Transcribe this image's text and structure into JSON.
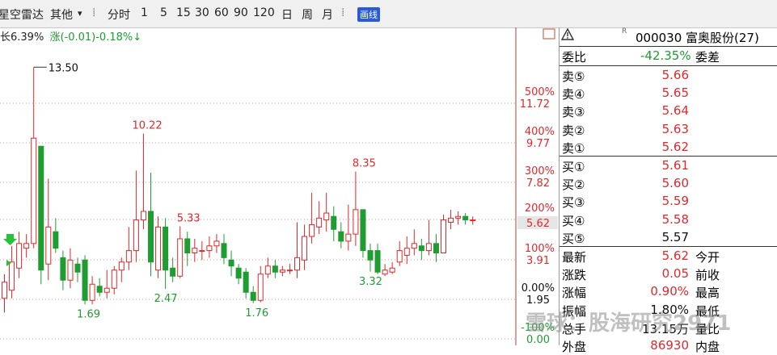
{
  "toolbar": {
    "name": "星空雷达",
    "other": "其他",
    "dropdown": "▾",
    "periods": [
      "分时",
      "1",
      "5",
      "15",
      "30",
      "60",
      "90",
      "120",
      "日",
      "周",
      "月"
    ],
    "draw_badge": "画线"
  },
  "info": {
    "left_fragment": "长6.39%",
    "change": "涨(-0.01)-0.18%↓"
  },
  "right_axis": [
    {
      "pct": "500%",
      "price": "11.72"
    },
    {
      "pct": "400%",
      "price": "9.77"
    },
    {
      "pct": "300%",
      "price": "7.82"
    },
    {
      "pct": "200%",
      "price": "5.62"
    },
    {
      "pct": "100%",
      "price": "3.91"
    },
    {
      "pct": "0.00%",
      "price": "1.95"
    },
    {
      "pct": "-100%",
      "price": "0.00"
    }
  ],
  "annotations": [
    "13.50",
    "10.22",
    "5.33",
    "8.35",
    "2.47",
    "1.69",
    "1.76",
    "3.32"
  ],
  "panel": {
    "code_line": "000030 富奥股份(27)",
    "r_mark": "R",
    "weibi_label": "委比",
    "weibi_value": "-42.35%",
    "weicha_label": "委差",
    "asks": [
      {
        "label": "卖⑤",
        "price": "5.66"
      },
      {
        "label": "卖④",
        "price": "5.65"
      },
      {
        "label": "卖③",
        "price": "5.64"
      },
      {
        "label": "卖②",
        "price": "5.63"
      },
      {
        "label": "卖①",
        "price": "5.62"
      }
    ],
    "bids": [
      {
        "label": "买①",
        "price": "5.61"
      },
      {
        "label": "买②",
        "price": "5.60"
      },
      {
        "label": "买③",
        "price": "5.59"
      },
      {
        "label": "买④",
        "price": "5.58"
      },
      {
        "label": "买⑤",
        "price": "5.57"
      }
    ],
    "stats": [
      {
        "label": "最新",
        "value": "5.62",
        "label2": "今开"
      },
      {
        "label": "涨跌",
        "value": "0.05",
        "label2": "前收"
      },
      {
        "label": "涨幅",
        "value": "0.90%",
        "label2": "最高"
      },
      {
        "label": "振幅",
        "value": "1.80%",
        "label2": "最低"
      },
      {
        "label": "总手",
        "value": "13.15万",
        "label2": "量比"
      },
      {
        "label": "外盘",
        "value": "86930",
        "label2": "内盘"
      }
    ]
  },
  "watermark": "雪球：股海研究2971",
  "colors": {
    "up": "#e0282c",
    "down": "#1f9c32",
    "grid": "#ce9a9a"
  },
  "chart_data": {
    "type": "candlestick",
    "price_levels": [
      11.72,
      9.77,
      7.82,
      5.62,
      3.91,
      1.95,
      0.0
    ],
    "bars": [
      {
        "o": 2.0,
        "c": 2.8,
        "h": 3.2,
        "l": 1.3
      },
      {
        "o": 2.4,
        "c": 3.8,
        "h": 4.5,
        "l": 2.0
      },
      {
        "o": 3.5,
        "c": 4.6,
        "h": 5.1,
        "l": 3.0
      },
      {
        "o": 4.4,
        "c": 4.6,
        "h": 5.0,
        "l": 4.0
      },
      {
        "o": 4.6,
        "c": 10.0,
        "h": 13.5,
        "l": 4.4
      },
      {
        "o": 9.6,
        "c": 3.4,
        "h": 9.6,
        "l": 2.7
      },
      {
        "o": 3.7,
        "c": 5.3,
        "h": 8.0,
        "l": 2.9
      },
      {
        "o": 5.1,
        "c": 4.4,
        "h": 5.7,
        "l": 4.2
      },
      {
        "o": 4.0,
        "c": 2.9,
        "h": 4.3,
        "l": 2.4
      },
      {
        "o": 2.9,
        "c": 3.9,
        "h": 4.4,
        "l": 2.5
      },
      {
        "o": 3.7,
        "c": 3.3,
        "h": 4.0,
        "l": 2.8
      },
      {
        "o": 3.9,
        "c": 1.9,
        "h": 4.1,
        "l": 1.7
      },
      {
        "o": 1.9,
        "c": 2.7,
        "h": 3.1,
        "l": 1.7
      },
      {
        "o": 2.6,
        "c": 2.3,
        "h": 3.0,
        "l": 2.1
      },
      {
        "o": 2.3,
        "c": 2.5,
        "h": 3.4,
        "l": 2.0
      },
      {
        "o": 2.5,
        "c": 3.4,
        "h": 3.6,
        "l": 2.2
      },
      {
        "o": 3.4,
        "c": 3.8,
        "h": 4.0,
        "l": 2.8
      },
      {
        "o": 3.8,
        "c": 4.3,
        "h": 5.3,
        "l": 3.4
      },
      {
        "o": 4.3,
        "c": 5.6,
        "h": 8.4,
        "l": 3.8
      },
      {
        "o": 5.6,
        "c": 6.1,
        "h": 10.22,
        "l": 5.2
      },
      {
        "o": 6.1,
        "c": 3.8,
        "h": 8.3,
        "l": 3.1
      },
      {
        "o": 3.4,
        "c": 5.3,
        "h": 5.8,
        "l": 3.0
      },
      {
        "o": 5.3,
        "c": 3.4,
        "h": 5.7,
        "l": 2.47
      },
      {
        "o": 3.5,
        "c": 3.1,
        "h": 4.0,
        "l": 2.8
      },
      {
        "o": 3.1,
        "c": 4.8,
        "h": 5.33,
        "l": 3.0
      },
      {
        "o": 4.8,
        "c": 4.2,
        "h": 5.1,
        "l": 3.6
      },
      {
        "o": 4.2,
        "c": 4.4,
        "h": 4.8,
        "l": 3.8
      },
      {
        "o": 4.3,
        "c": 4.3,
        "h": 4.7,
        "l": 3.9
      },
      {
        "o": 4.3,
        "c": 4.5,
        "h": 4.9,
        "l": 4.0
      },
      {
        "o": 4.5,
        "c": 4.7,
        "h": 5.0,
        "l": 4.2
      },
      {
        "o": 4.6,
        "c": 4.0,
        "h": 5.0,
        "l": 3.7
      },
      {
        "o": 3.9,
        "c": 3.6,
        "h": 4.3,
        "l": 3.1
      },
      {
        "o": 3.5,
        "c": 3.0,
        "h": 3.7,
        "l": 2.7
      },
      {
        "o": 3.3,
        "c": 2.3,
        "h": 3.5,
        "l": 2.0
      },
      {
        "o": 2.3,
        "c": 1.9,
        "h": 2.6,
        "l": 1.76
      },
      {
        "o": 1.9,
        "c": 3.2,
        "h": 3.6,
        "l": 1.8
      },
      {
        "o": 3.2,
        "c": 3.6,
        "h": 4.0,
        "l": 3.0
      },
      {
        "o": 3.6,
        "c": 3.3,
        "h": 3.9,
        "l": 3.0
      },
      {
        "o": 3.3,
        "c": 3.4,
        "h": 3.6,
        "l": 3.1
      },
      {
        "o": 3.4,
        "c": 3.4,
        "h": 3.7,
        "l": 3.2
      },
      {
        "o": 3.4,
        "c": 4.0,
        "h": 5.5,
        "l": 3.0
      },
      {
        "o": 3.9,
        "c": 4.9,
        "h": 5.4,
        "l": 3.4
      },
      {
        "o": 4.9,
        "c": 5.4,
        "h": 7.2,
        "l": 4.6
      },
      {
        "o": 5.3,
        "c": 5.7,
        "h": 6.7,
        "l": 5.0
      },
      {
        "o": 5.6,
        "c": 6.0,
        "h": 7.2,
        "l": 5.1
      },
      {
        "o": 5.8,
        "c": 5.2,
        "h": 6.4,
        "l": 4.7
      },
      {
        "o": 5.1,
        "c": 4.7,
        "h": 5.5,
        "l": 4.4
      },
      {
        "o": 4.7,
        "c": 5.0,
        "h": 6.5,
        "l": 4.3
      },
      {
        "o": 5.0,
        "c": 6.2,
        "h": 8.35,
        "l": 4.5
      },
      {
        "o": 6.2,
        "c": 4.3,
        "h": 6.2,
        "l": 4.0
      },
      {
        "o": 4.3,
        "c": 3.9,
        "h": 4.6,
        "l": 3.32
      },
      {
        "o": 4.3,
        "c": 3.3,
        "h": 4.6,
        "l": 3.2
      },
      {
        "o": 3.2,
        "c": 3.4,
        "h": 3.7,
        "l": 3.1
      },
      {
        "o": 3.3,
        "c": 3.5,
        "h": 3.8,
        "l": 3.2
      },
      {
        "o": 3.8,
        "c": 4.3,
        "h": 4.7,
        "l": 3.6
      },
      {
        "o": 4.1,
        "c": 4.4,
        "h": 4.9,
        "l": 3.7
      },
      {
        "o": 4.4,
        "c": 4.6,
        "h": 5.2,
        "l": 4.1
      },
      {
        "o": 4.5,
        "c": 4.3,
        "h": 4.8,
        "l": 3.9
      },
      {
        "o": 4.3,
        "c": 4.6,
        "h": 5.6,
        "l": 4.1
      },
      {
        "o": 4.6,
        "c": 4.2,
        "h": 5.0,
        "l": 3.8
      },
      {
        "o": 4.2,
        "c": 5.6,
        "h": 5.9,
        "l": 4.2
      },
      {
        "o": 5.5,
        "c": 5.7,
        "h": 6.2,
        "l": 5.2
      },
      {
        "o": 5.7,
        "c": 5.8,
        "h": 6.1,
        "l": 5.4
      },
      {
        "o": 5.8,
        "c": 5.6,
        "h": 6.0,
        "l": 5.4
      },
      {
        "o": 5.6,
        "c": 5.6,
        "h": 5.8,
        "l": 5.4
      }
    ]
  }
}
